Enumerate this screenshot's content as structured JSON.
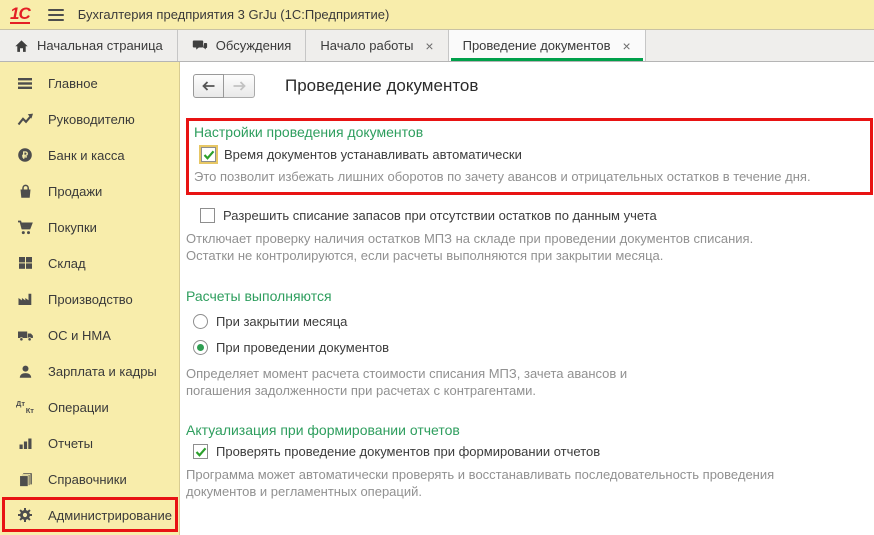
{
  "window": {
    "logo": "1С",
    "app_title": "Бухгалтерия предприятия 3 GrJu  (1С:Предприятие)"
  },
  "icons": {
    "close": "×"
  },
  "tabs": [
    {
      "label": "Начальная страница",
      "icon": "home-icon",
      "closable": false,
      "active": false
    },
    {
      "label": "Обсуждения",
      "icon": "chat-icon",
      "closable": false,
      "active": false
    },
    {
      "label": "Начало работы",
      "icon": null,
      "closable": true,
      "active": false
    },
    {
      "label": "Проведение документов",
      "icon": null,
      "closable": true,
      "active": true
    }
  ],
  "sidebar": {
    "items": [
      {
        "label": "Главное",
        "icon": "menu-icon"
      },
      {
        "label": "Руководителю",
        "icon": "trend-up-icon"
      },
      {
        "label": "Банк и касса",
        "icon": "ruble-circle-icon"
      },
      {
        "label": "Продажи",
        "icon": "bag-icon"
      },
      {
        "label": "Покупки",
        "icon": "cart-icon"
      },
      {
        "label": "Склад",
        "icon": "grid-icon"
      },
      {
        "label": "Производство",
        "icon": "factory-icon"
      },
      {
        "label": "ОС и НМА",
        "icon": "truck-icon"
      },
      {
        "label": "Зарплата и кадры",
        "icon": "person-icon"
      },
      {
        "label": "Операции",
        "icon": "debit-credit-icon"
      },
      {
        "label": "Отчеты",
        "icon": "bar-chart-icon"
      },
      {
        "label": "Справочники",
        "icon": "books-icon"
      },
      {
        "label": "Администрирование",
        "icon": "gear-icon",
        "annotated": true
      }
    ],
    "dtkt": {
      "dt": "Дт",
      "kt": "Кт"
    }
  },
  "main": {
    "title": "Проведение документов",
    "posting_settings": {
      "heading": "Настройки проведения документов",
      "auto_time": {
        "label": "Время документов устанавливать автоматически",
        "checked": true
      },
      "hint": "Это позволит избежать лишних оборотов по зачету авансов и отрицательных остатков в течение дня."
    },
    "stock_writeoff": {
      "label": "Разрешить списание запасов при отсутствии остатков по данным учета",
      "checked": false,
      "hint": "Отключает проверку наличия остатков МПЗ на складе при проведении документов списания. Остатки не контролируются, если расчеты выполняются при закрытии месяца."
    },
    "calculations": {
      "heading": "Расчеты выполняются",
      "options": [
        {
          "label": "При закрытии месяца",
          "selected": false
        },
        {
          "label": "При проведении документов",
          "selected": true
        }
      ],
      "hint": "Определяет момент расчета стоимости списания МПЗ, зачета авансов и погашения задолженности при расчетах с контрагентами."
    },
    "actualization": {
      "heading": "Актуализация при формировании отчетов",
      "check_posting": {
        "label": "Проверять проведение документов при формировании отчетов",
        "checked": true
      },
      "hint": "Программа может автоматически проверять и восстанавливать последовательность проведения документов и регламентных операций."
    },
    "colors": {
      "accent_green": "#2e9e5e",
      "tab_underline_green": "#00a04a",
      "panel_yellow": "#f8edab",
      "annotation_red": "#e81313",
      "logo_red": "#e31e24"
    }
  }
}
